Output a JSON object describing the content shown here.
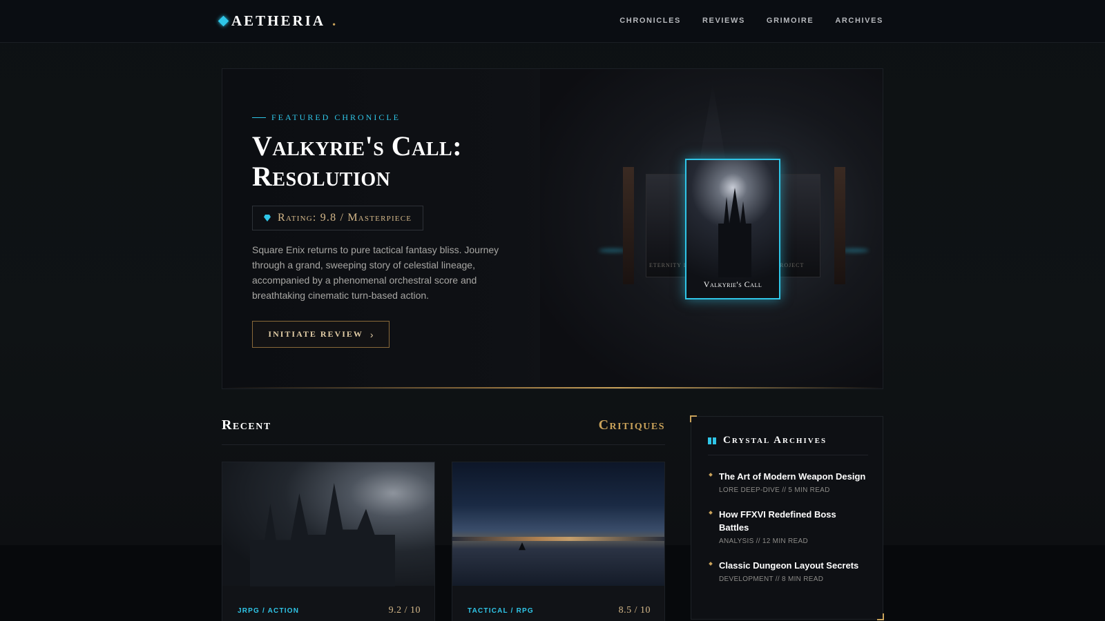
{
  "brand": {
    "name": "AETHERIA",
    "dot": "."
  },
  "nav": {
    "items": [
      "CHRONICLES",
      "REVIEWS",
      "GRIMOIRE",
      "ARCHIVES"
    ]
  },
  "hero": {
    "eyebrow": "FEATURED CHRONICLE",
    "title_line1": "Valkyrie's Call:",
    "title_line2": "Resolution",
    "rating": "Rating: 9.8 / Masterpiece",
    "description": "Square Enix returns to pure tactical fantasy bliss. Journey through a grand, sweeping story of celestial lineage, accompanied by a phenomenal orchestral score and breathtaking cinematic turn-based action.",
    "cta_label": "INITIATE REVIEW",
    "cards": {
      "main": "Valkyrie's Call",
      "left": "ETERNITY DAWN",
      "right": "PROJECT"
    }
  },
  "recent": {
    "left_title": "Recent",
    "right_title": "Critiques",
    "items": [
      {
        "genre": "JRPG / ACTION",
        "score": "9.2 / 10"
      },
      {
        "genre": "TACTICAL / RPG",
        "score": "8.5 / 10"
      }
    ]
  },
  "archives": {
    "title": "Crystal Archives",
    "items": [
      {
        "title": "The Art of Modern Weapon Design",
        "meta": "LORE DEEP-DIVE // 5 MIN READ"
      },
      {
        "title": "How FFXVI Redefined Boss Battles",
        "meta": "ANALYSIS // 12 MIN READ"
      },
      {
        "title": "Classic Dungeon Layout Secrets",
        "meta": "DEVELOPMENT // 8 MIN READ"
      }
    ]
  },
  "colors": {
    "accent": "#2fc6e8",
    "gold": "#c9a25a",
    "background": "#0b0d10"
  },
  "icons": {
    "logo": "diamond-gem-icon",
    "rating": "gem-icon",
    "cta": "chevron-right-icon",
    "archives": "book-icon"
  }
}
